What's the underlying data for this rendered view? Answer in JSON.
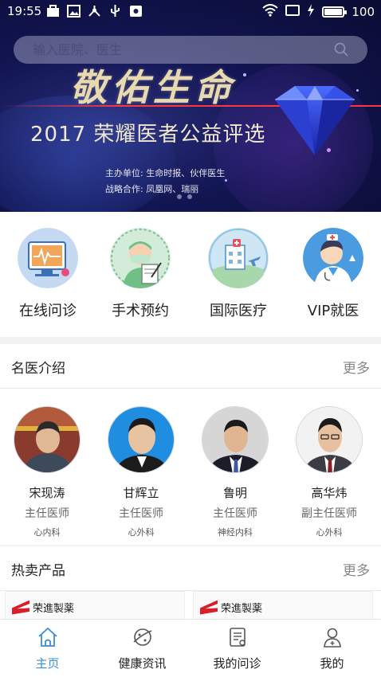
{
  "status_bar": {
    "time": "19:55",
    "battery": "100",
    "icons_left": [
      "briefcase-icon",
      "image-icon",
      "network-icon",
      "usb-icon",
      "notification-icon"
    ],
    "icons_right": [
      "wifi-icon",
      "sim-icon",
      "charging-icon",
      "battery-icon"
    ]
  },
  "search": {
    "placeholder": "输入医院、医生"
  },
  "banner": {
    "calligraphy": "敬佑生命",
    "title": "2017 荣耀医者公益评选",
    "organizer": "主办单位:    生命时报、伙伴医生",
    "partner": "战略合作:    凤凰网、瑞丽",
    "page_count": 2
  },
  "quick_menu": [
    {
      "label": "在线问诊",
      "icon": "monitor-ecg-icon"
    },
    {
      "label": "手术预约",
      "icon": "surgeon-icon"
    },
    {
      "label": "国际医疗",
      "icon": "hospital-plane-icon"
    },
    {
      "label": "VIP就医",
      "icon": "doctor-icon"
    }
  ],
  "doctors_section": {
    "title": "名医介绍",
    "more": "更多",
    "doctors": [
      {
        "name": "宋现涛",
        "title": "主任医师",
        "dept": "心内科"
      },
      {
        "name": "甘辉立",
        "title": "主任医师",
        "dept": "心外科"
      },
      {
        "name": "鲁明",
        "title": "主任医师",
        "dept": "神经内科"
      },
      {
        "name": "高华炜",
        "title": "副主任医师",
        "dept": "心外科"
      }
    ]
  },
  "products_section": {
    "title": "热卖产品",
    "more": "更多",
    "products": [
      {
        "brand": "荣進製薬"
      },
      {
        "brand": "荣進製薬"
      }
    ]
  },
  "tabbar": {
    "tabs": [
      {
        "label": "主页",
        "icon": "home-icon",
        "active": true
      },
      {
        "label": "健康资讯",
        "icon": "planet-icon",
        "active": false
      },
      {
        "label": "我的问诊",
        "icon": "document-icon",
        "active": false
      },
      {
        "label": "我的",
        "icon": "user-icon",
        "active": false
      }
    ],
    "active_color": "#3a8fd6"
  }
}
